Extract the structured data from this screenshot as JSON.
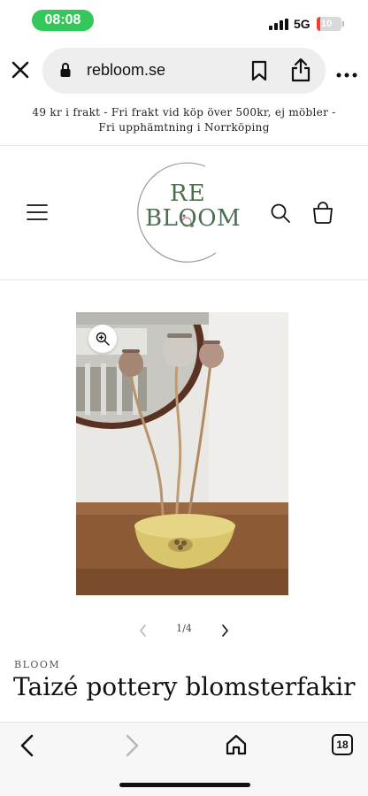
{
  "status_bar": {
    "time": "08:08",
    "network": "5G",
    "battery": "10",
    "battery_level": 0.1
  },
  "browser": {
    "url": "rebloom.se",
    "tab_count": "18"
  },
  "announcement": {
    "line1": "49 kr i frakt - Fri frakt vid köp över 500kr, ej möbler -",
    "line2": "Fri upphämtning i Norrköping"
  },
  "logo": {
    "top": "RE",
    "bottom": "BLOOM"
  },
  "product": {
    "slider_counter": "1/4",
    "vendor": "BLOOM",
    "title": "Taizé pottery blomsterfakir"
  },
  "icons": {
    "close": "close-icon",
    "lock": "lock-icon",
    "bookmark": "bookmark-icon",
    "share": "share-icon",
    "more": "more-icon",
    "menu": "menu-icon",
    "search": "search-icon",
    "cart": "cart-icon",
    "zoom": "zoom-icon",
    "back": "back-icon",
    "forward": "forward-icon",
    "home": "home-icon"
  },
  "colors": {
    "status_pill": "#34c759",
    "logo_green": "#4c6d4f",
    "battery_low": "#ff3b30"
  }
}
